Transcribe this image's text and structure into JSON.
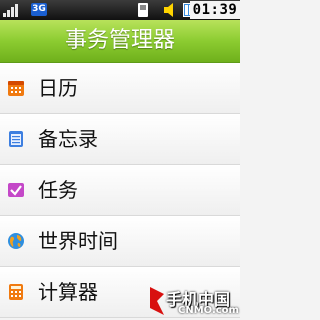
{
  "status_bar": {
    "network_label": "3G",
    "time": "01:39",
    "signal_icon": "signal-icon",
    "sd_card_icon": "sd-card-icon",
    "speaker_icon": "speaker-icon",
    "battery_icon": "battery-icon"
  },
  "header": {
    "title": "事务管理器",
    "color": "#8ccc31"
  },
  "menu": {
    "items": [
      {
        "label": "日历",
        "icon": "calendar-icon"
      },
      {
        "label": "备忘录",
        "icon": "memo-icon"
      },
      {
        "label": "任务",
        "icon": "task-icon"
      },
      {
        "label": "世界时间",
        "icon": "world-clock-icon"
      },
      {
        "label": "计算器",
        "icon": "calculator-icon"
      }
    ]
  },
  "watermark": {
    "title": "手机中国",
    "subtitle": "CNMO.com"
  }
}
